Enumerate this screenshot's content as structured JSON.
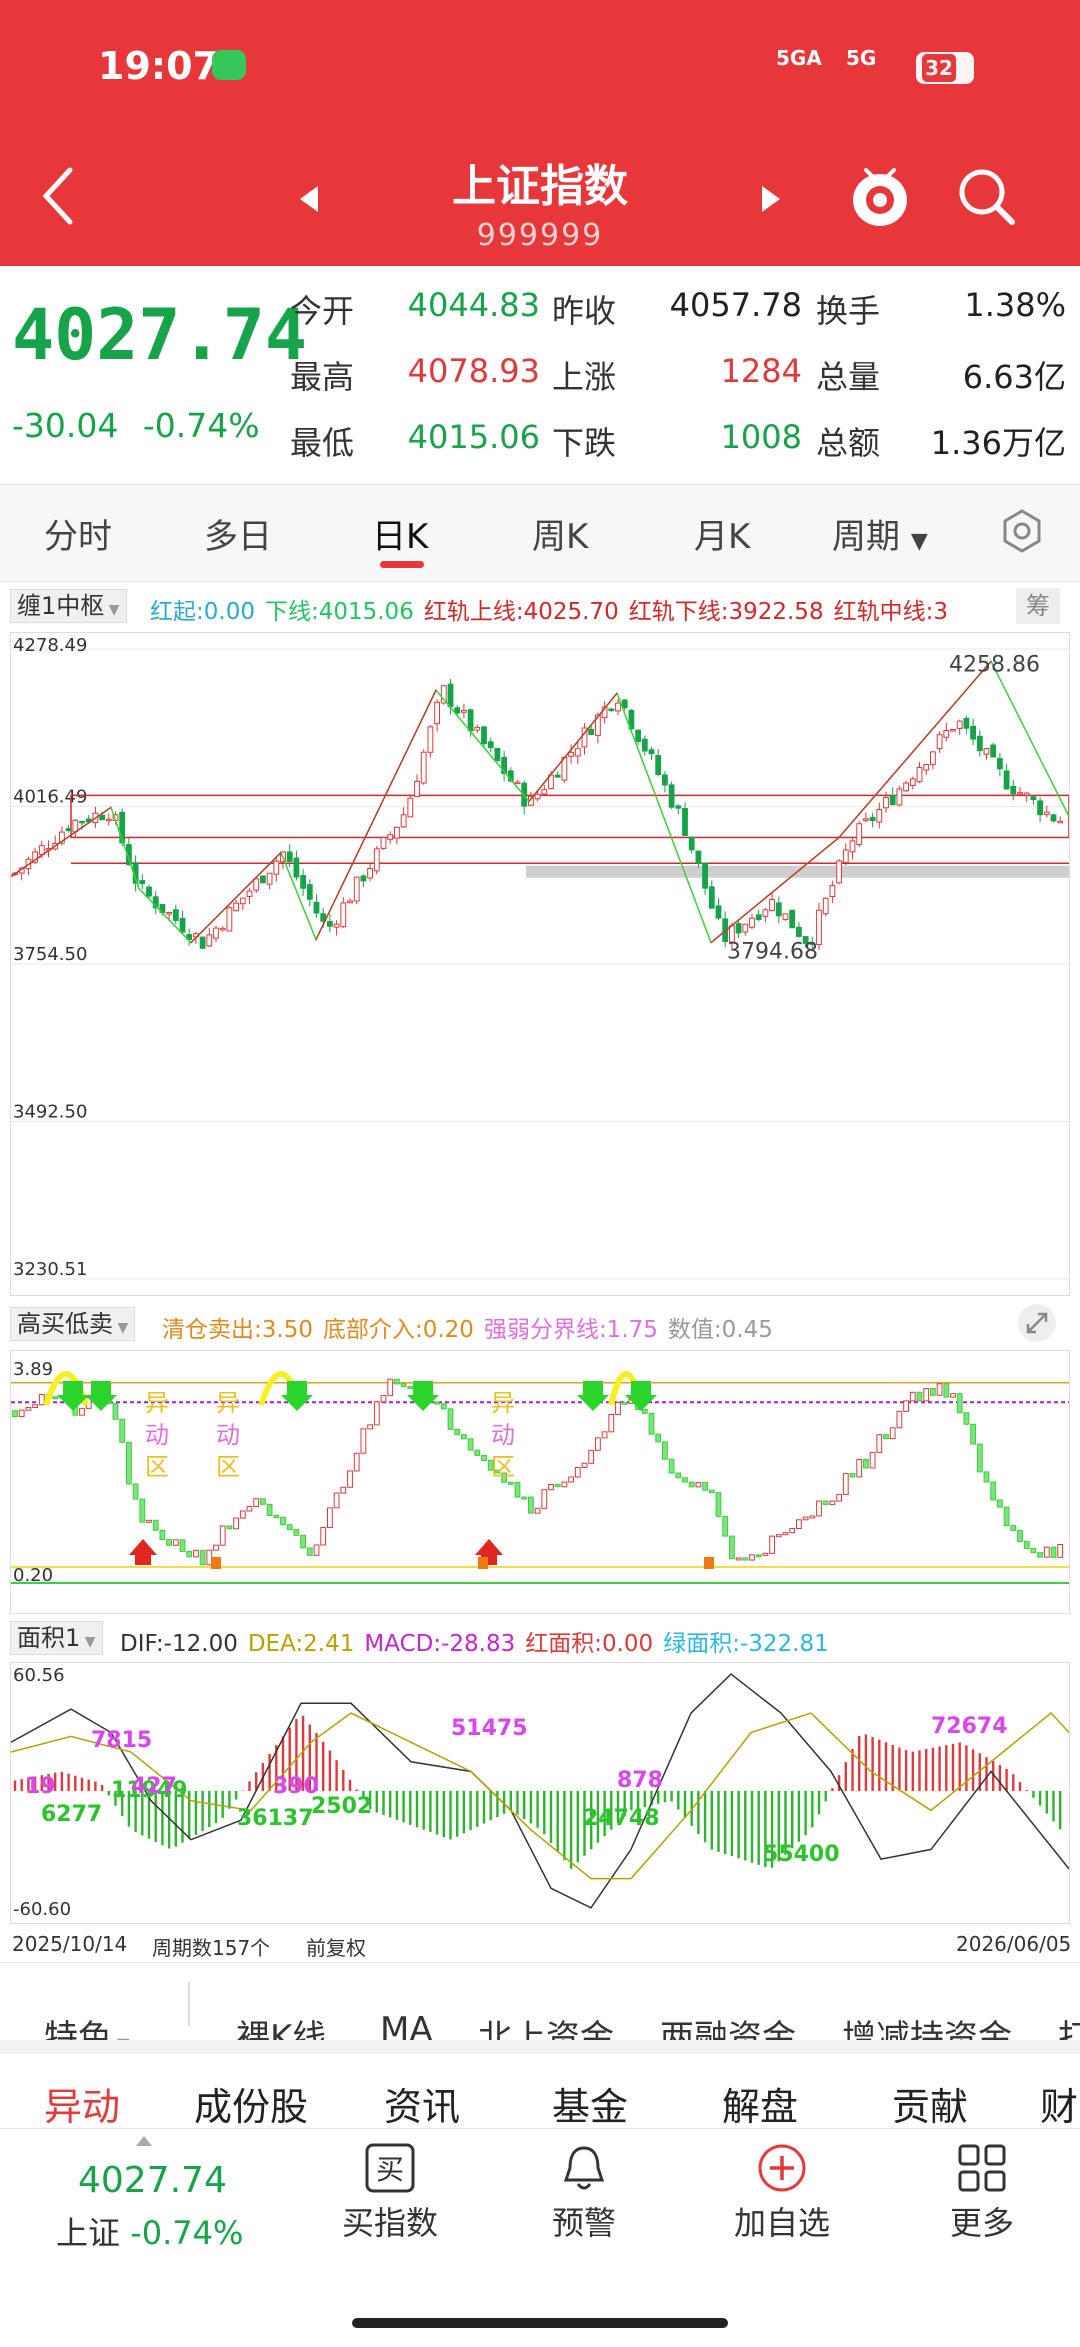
{
  "status": {
    "time": "19:07",
    "sig1": "5GA",
    "sig2": "5G",
    "battery": "32"
  },
  "header": {
    "title": "上证指数",
    "code": "999999"
  },
  "quote": {
    "price": "4027.74",
    "change": "-30.04",
    "pct": "-0.74%",
    "rows": [
      [
        {
          "l": "今开",
          "v": "4044.83",
          "c": "green"
        },
        {
          "l": "昨收",
          "v": "4057.78",
          "c": "black"
        },
        {
          "l": "换手",
          "v": "1.38%",
          "c": "black"
        }
      ],
      [
        {
          "l": "最高",
          "v": "4078.93",
          "c": "red"
        },
        {
          "l": "上涨",
          "v": "1284",
          "c": "red"
        },
        {
          "l": "总量",
          "v": "6.63亿",
          "c": "black"
        }
      ],
      [
        {
          "l": "最低",
          "v": "4015.06",
          "c": "green"
        },
        {
          "l": "下跌",
          "v": "1008",
          "c": "green"
        },
        {
          "l": "总额",
          "v": "1.36万亿",
          "c": "black"
        }
      ]
    ]
  },
  "tabs": [
    "分时",
    "多日",
    "日K",
    "周K",
    "月K",
    "周期"
  ],
  "main_ind": {
    "btn": "缠1中枢",
    "items": [
      {
        "t": "红起:0.00",
        "c": "#2aa9d8"
      },
      {
        "t": "下线:4015.06",
        "c": "#22c55e"
      },
      {
        "t": "红轨上线:4025.70",
        "c": "#d62728"
      },
      {
        "t": "红轨下线:3922.58",
        "c": "#d62728"
      },
      {
        "t": "红轨中线:3",
        "c": "#d62728"
      }
    ],
    "chip": "筹",
    "axis": [
      "4278.49",
      "4016.49",
      "3754.50",
      "3492.50",
      "3230.51"
    ],
    "high_label": "4258.86",
    "low_label": "3794.68"
  },
  "ind2": {
    "btn": "高买低卖",
    "items": [
      {
        "t": "清仓卖出:3.50",
        "c": "#e08a1e"
      },
      {
        "t": "底部介入:0.20",
        "c": "#e08a1e"
      },
      {
        "t": "强弱分界线:1.75",
        "c": "#e06fe0"
      },
      {
        "t": "数值:0.45",
        "c": "#999999"
      }
    ],
    "axis": [
      "3.89",
      "0.20"
    ],
    "zone": "异动区"
  },
  "ind3": {
    "btn": "面积1",
    "items": [
      {
        "t": "DIF:-12.00",
        "c": "#333333"
      },
      {
        "t": "DEA:2.41",
        "c": "#b8a000"
      },
      {
        "t": "MACD:-28.83",
        "c": "#c026d3"
      },
      {
        "t": "红面积:0.00",
        "c": "#e0393b"
      },
      {
        "t": "绿面积:-322.81",
        "c": "#2ab7e8"
      }
    ],
    "axis": [
      "60.56",
      "-60.60"
    ],
    "labels": [
      "7815",
      "19",
      "6277",
      "11949",
      "427",
      "390",
      "36137",
      "2502",
      "51475",
      "878",
      "24748",
      "55400",
      "72674"
    ]
  },
  "footer_axis": {
    "start": "2025/10/14",
    "count": "周期数157个",
    "adj": "前复权",
    "end": "2026/06/05"
  },
  "feature_tabs": [
    "特色",
    "裸K线",
    "MA",
    "北上资金",
    "两融资金",
    "增减持资金",
    "打"
  ],
  "detail_tabs": [
    "异动",
    "成份股",
    "资讯",
    "基金",
    "解盘",
    "贡献",
    "财"
  ],
  "nav": {
    "price": "4027.74",
    "name": "上证",
    "pct": "-0.74%",
    "items": [
      "买指数",
      "预警",
      "加自选",
      "更多"
    ]
  }
}
